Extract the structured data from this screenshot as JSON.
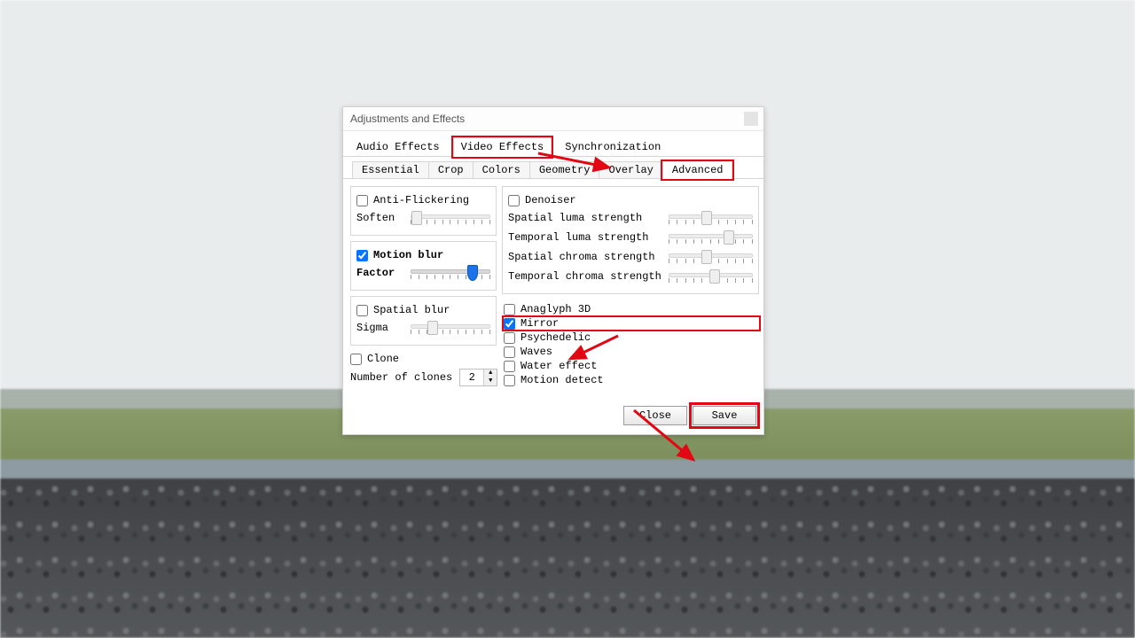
{
  "window": {
    "title": "Adjustments and Effects"
  },
  "main_tabs": {
    "audio": "Audio Effects",
    "video": "Video Effects",
    "sync": "Synchronization"
  },
  "sub_tabs": {
    "essential": "Essential",
    "crop": "Crop",
    "colors": "Colors",
    "geometry": "Geometry",
    "overlay": "Overlay",
    "advanced": "Advanced"
  },
  "antiflicker": {
    "label": "Anti-Flickering",
    "checked": false,
    "soften_label": "Soften",
    "soften_pct": 8
  },
  "motionblur": {
    "label": "Motion blur",
    "checked": true,
    "factor_label": "Factor",
    "factor_pct": 78
  },
  "spatialblur": {
    "label": "Spatial blur",
    "checked": false,
    "sigma_label": "Sigma",
    "sigma_pct": 28
  },
  "clone": {
    "label": "Clone",
    "checked": false,
    "num_label": "Number of clones",
    "value": "2"
  },
  "denoiser": {
    "label": "Denoiser",
    "checked": false,
    "rows": [
      {
        "label": "Spatial luma strength",
        "pct": 45
      },
      {
        "label": "Temporal luma strength",
        "pct": 72
      },
      {
        "label": "Spatial chroma strength",
        "pct": 45
      },
      {
        "label": "Temporal chroma strength",
        "pct": 55
      }
    ]
  },
  "right_checks": [
    {
      "key": "anaglyph",
      "label": "Anaglyph 3D",
      "checked": false
    },
    {
      "key": "mirror",
      "label": "Mirror",
      "checked": true
    },
    {
      "key": "psychedelic",
      "label": "Psychedelic",
      "checked": false
    },
    {
      "key": "waves",
      "label": "Waves",
      "checked": false
    },
    {
      "key": "water",
      "label": "Water effect",
      "checked": false
    },
    {
      "key": "motiondetect",
      "label": "Motion detect",
      "checked": false
    }
  ],
  "footer": {
    "close": "Close",
    "save": "Save"
  }
}
